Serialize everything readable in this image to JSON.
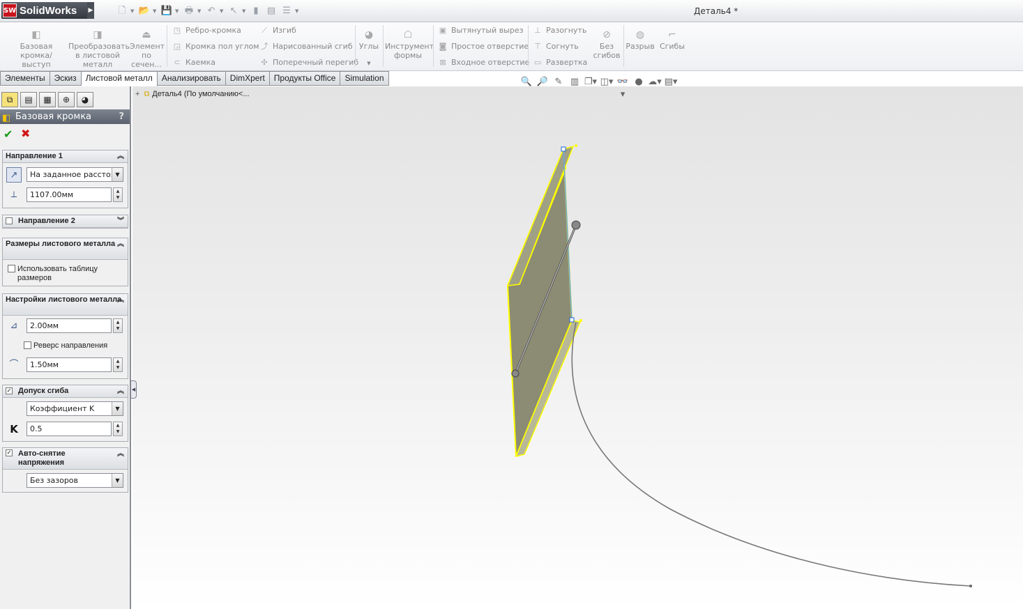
{
  "app": {
    "name": "SolidWorks",
    "logo_text": "SW",
    "doc_title": "Деталь4 *"
  },
  "colors": {
    "accent": "#c8141c",
    "panel_header": "#5b626d",
    "selection": "#ffff00",
    "part_face": "#8c8c74"
  },
  "ribbon": {
    "big": [
      {
        "id": "base-flange",
        "label": "Базовая кромка/выступ",
        "icon": "base-flange-icon"
      },
      {
        "id": "convert",
        "label": "Преобразовать в листовой металл",
        "icon": "convert-sheetmetal-icon"
      },
      {
        "id": "lofted",
        "label": "Элемент по сечен...",
        "icon": "lofted-bend-icon"
      },
      {
        "id": "corners",
        "label": "Углы",
        "icon": "corners-icon"
      },
      {
        "id": "forming",
        "label": "Инструмент формы",
        "icon": "forming-tool-icon"
      },
      {
        "id": "no-bends",
        "label": "Без сгибов",
        "icon": "no-bends-icon"
      },
      {
        "id": "rip",
        "label": "Разрыв",
        "icon": "rip-icon"
      },
      {
        "id": "bends",
        "label": "Сгибы",
        "icon": "insert-bends-icon"
      }
    ],
    "small": [
      {
        "label": "Ребро-кромка"
      },
      {
        "label": "Кромка пол углом"
      },
      {
        "label": "Каемка"
      },
      {
        "label": "Изгиб"
      },
      {
        "label": "Нарисованный сгиб"
      },
      {
        "label": "Поперечный перегиб"
      },
      {
        "label": "Вытянутый вырез"
      },
      {
        "label": "Простое отверстие"
      },
      {
        "label": "Входное отверстие"
      },
      {
        "label": "Разогнуть"
      },
      {
        "label": "Согнуть"
      },
      {
        "label": "Развертка"
      }
    ]
  },
  "tabs": [
    {
      "label": "Элементы",
      "active": false
    },
    {
      "label": "Эскиз",
      "active": false
    },
    {
      "label": "Листовой металл",
      "active": true
    },
    {
      "label": "Анализировать",
      "active": false
    },
    {
      "label": "DimXpert",
      "active": false
    },
    {
      "label": "Продукты Office",
      "active": false
    },
    {
      "label": "Simulation",
      "active": false
    }
  ],
  "pm": {
    "title": "Базовая кромка",
    "help": "?",
    "dir1": {
      "title": "Направление 1",
      "end_condition": "На заданное расстоянии",
      "distance": "1107.00мм"
    },
    "dir2": {
      "title": "Направление 2"
    },
    "gauge": {
      "title": "Размеры листового металла",
      "use_table": "Использовать таблицу размеров"
    },
    "params": {
      "title": "Настройки листового металла",
      "thickness": "2.00мм",
      "reverse": "Реверс направления",
      "radius": "1.50мм"
    },
    "bend_allowance": {
      "title": "Допуск сгиба",
      "type": "Коэффициент K",
      "k_label": "K",
      "k_value": "0.5"
    },
    "relief": {
      "title": "Авто-снятие напряжения",
      "type": "Без зазоров"
    }
  },
  "tree": {
    "label": "Деталь4  (По умолчанию<..."
  }
}
